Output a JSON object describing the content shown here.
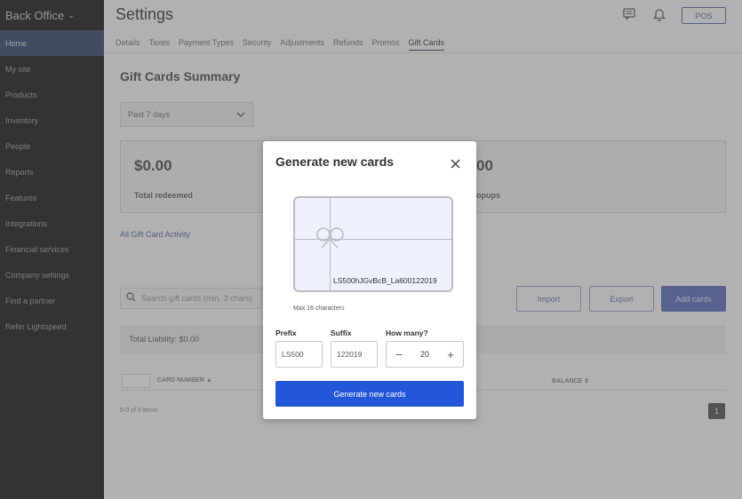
{
  "sidebar": {
    "brand": "Back Office",
    "items": [
      {
        "label": "Home"
      },
      {
        "label": "My site"
      },
      {
        "label": "Products"
      },
      {
        "label": "Inventory"
      },
      {
        "label": "People"
      },
      {
        "label": "Reports"
      },
      {
        "label": "Features"
      },
      {
        "label": "Integrations"
      },
      {
        "label": "Financial services"
      },
      {
        "label": "Company settings"
      },
      {
        "label": "Find a partner"
      },
      {
        "label": "Refer Lightspeed"
      }
    ]
  },
  "header": {
    "title": "Settings",
    "pos_label": "POS",
    "tabs": [
      "Details",
      "Taxes",
      "Payment Types",
      "Security",
      "Adjustments",
      "Refunds",
      "Promos",
      "Gift Cards"
    ]
  },
  "summary": {
    "title": "Gift Cards Summary",
    "date_range": "Past 7 days",
    "stats": [
      {
        "value": "$0.00",
        "label": "Total redeemed"
      },
      {
        "value": "00",
        "label": "opups"
      }
    ],
    "activity_link": "All Gift Card Activity"
  },
  "toolbar": {
    "search_placeholder": "Search gift cards (min. 3 chars)",
    "import_label": "Import",
    "export_label": "Export",
    "add_label": "Add cards"
  },
  "liability": "Total Liability: $0.00",
  "table": {
    "col_card": "CARD NUMBER",
    "col_balance": "BALANCE",
    "items_count": "0-0 of 0 items",
    "page": "1"
  },
  "modal": {
    "title": "Generate new cards",
    "card_code": "LS500hJGvBcB_La600122019",
    "max_chars": "Max 16 characters",
    "prefix_label": "Prefix",
    "prefix_value": "LS500",
    "suffix_label": "Suffix",
    "suffix_value": "122019",
    "how_many_label": "How many?",
    "how_many_value": "20",
    "generate_label": "Generate new cards"
  }
}
